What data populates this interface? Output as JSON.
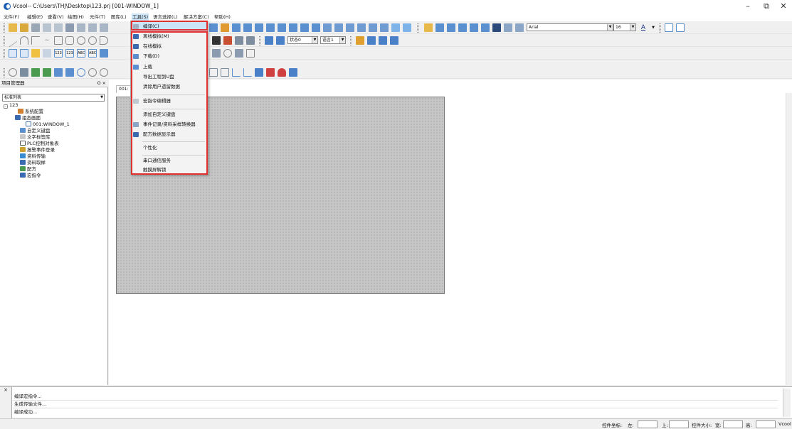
{
  "window": {
    "title": "Vcool-- C:\\Users\\THJ\\Desktop\\123.prj [001-WINDOW_1]",
    "minimize": "–",
    "restore": "⧉",
    "close": "✕"
  },
  "menubar": [
    {
      "label": "文件(F)"
    },
    {
      "label": "编辑(E)"
    },
    {
      "label": "查看(V)"
    },
    {
      "label": "绘图(H)"
    },
    {
      "label": "元件(T)"
    },
    {
      "label": "图库(L)"
    },
    {
      "label": "工具(S)"
    },
    {
      "label": "语言选择(L)"
    },
    {
      "label": "解决方案(C)"
    },
    {
      "label": "帮助(H)"
    }
  ],
  "toolbar": {
    "font_name": "Arial",
    "font_size": "16",
    "state_combo": "状态0",
    "language_combo": "语言1",
    "font_color_label": "A"
  },
  "project_panel": {
    "title": "项目管理器",
    "pin": "Ⲟ",
    "close": "×",
    "list_combo": "标准列表",
    "tree": [
      {
        "label": "123",
        "level": 0,
        "icon": "minus-box-icon"
      },
      {
        "label": "系统配置",
        "level": 1,
        "icon": "system-config-icon"
      },
      {
        "label": "组态画面",
        "level": 1,
        "icon": "screens-icon"
      },
      {
        "label": "001:WINDOW_1",
        "level": 2,
        "icon": "window-icon"
      },
      {
        "label": "自定义键盘",
        "level": 1,
        "icon": "keyboard-icon"
      },
      {
        "label": "文字标签库",
        "level": 1,
        "icon": "text-label-icon"
      },
      {
        "label": "PLC控制对象表",
        "level": 1,
        "icon": "plc-icon"
      },
      {
        "label": "报警事件登录",
        "level": 1,
        "icon": "alarm-icon"
      },
      {
        "label": "资料传输",
        "level": 1,
        "icon": "transfer-icon"
      },
      {
        "label": "资料取样",
        "level": 1,
        "icon": "sampling-icon"
      },
      {
        "label": "配方",
        "level": 1,
        "icon": "recipe-icon"
      },
      {
        "label": "宏指令",
        "level": 1,
        "icon": "macro-icon"
      }
    ]
  },
  "document_tab": "001:",
  "tools_menu": {
    "items": [
      {
        "label": "编译(C)",
        "icon": "compile-icon",
        "highlighted": true
      },
      {
        "label": "离线模拟(M)",
        "icon": "offline-sim-icon"
      },
      {
        "label": "在线模拟",
        "icon": "online-sim-icon"
      },
      {
        "label": "下载(D)",
        "icon": "download-icon"
      },
      {
        "label": "上载",
        "icon": "upload-icon"
      },
      {
        "label": "导出工程到U盘",
        "icon": ""
      },
      {
        "label": "清除用户遗留数据",
        "icon": ""
      },
      {
        "label": "宏指令编辑器",
        "icon": "macro-editor-icon",
        "sep_before": true
      },
      {
        "label": "添加自定义键盘",
        "icon": "",
        "sep_before": true
      },
      {
        "label": "事件记录/资料采样转换器",
        "icon": "event-converter-icon"
      },
      {
        "label": "配方数据显示器",
        "icon": "recipe-viewer-icon"
      },
      {
        "label": "个性化",
        "icon": "",
        "sep_before": true
      },
      {
        "label": "串口通信服务",
        "icon": "",
        "sep_before": true
      },
      {
        "label": "触摸屏解锁",
        "icon": ""
      }
    ]
  },
  "output": {
    "lines": [
      "编译宏指令...",
      "生成传输文件...",
      "编译成功..."
    ],
    "side_close": "×"
  },
  "statusbar": {
    "coord_label": "控件坐标:",
    "left_label": "左:",
    "top_label": "上:",
    "size_label": "控件大小:",
    "width_label": "宽:",
    "height_label": "高:",
    "app_name": "Vcool"
  },
  "colors": {
    "highlight": "#e03030",
    "brand": "#1a5fb4"
  }
}
